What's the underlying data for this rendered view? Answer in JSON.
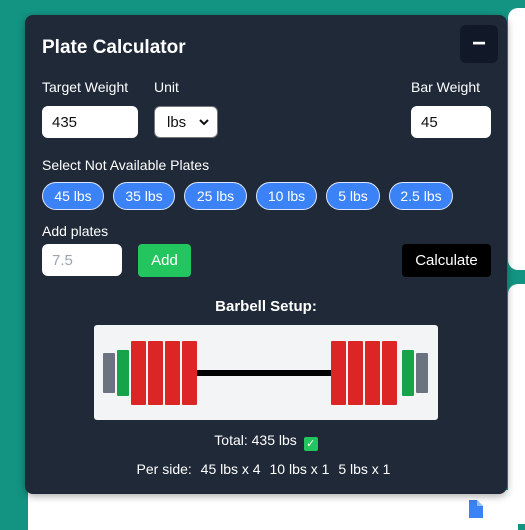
{
  "panel": {
    "title": "Plate Calculator",
    "minimize_label": "−"
  },
  "form": {
    "target_weight_label": "Target Weight",
    "target_weight_value": "435",
    "unit_label": "Unit",
    "unit_value": "lbs",
    "bar_weight_label": "Bar Weight",
    "bar_weight_value": "45",
    "not_available_label": "Select Not Available Plates",
    "plates": [
      "45 lbs",
      "35 lbs",
      "25 lbs",
      "10 lbs",
      "5 lbs",
      "2.5 lbs"
    ],
    "add_plates_label": "Add plates",
    "add_plates_placeholder": "7.5",
    "add_button": "Add",
    "calculate_button": "Calculate"
  },
  "result": {
    "setup_title": "Barbell Setup:",
    "total_text": "Total: 435 lbs",
    "per_side_label": "Per side:",
    "per_side": [
      "45 lbs x 4",
      "10 lbs x 1",
      "5 lbs x 1"
    ]
  },
  "colors": {
    "background": "#139483",
    "panel": "#1f2937",
    "plate_45": "#dc2626",
    "plate_10": "#16a34a",
    "plate_5": "#6b7280",
    "chip": "#3b82f6",
    "add_button": "#22c55e"
  }
}
